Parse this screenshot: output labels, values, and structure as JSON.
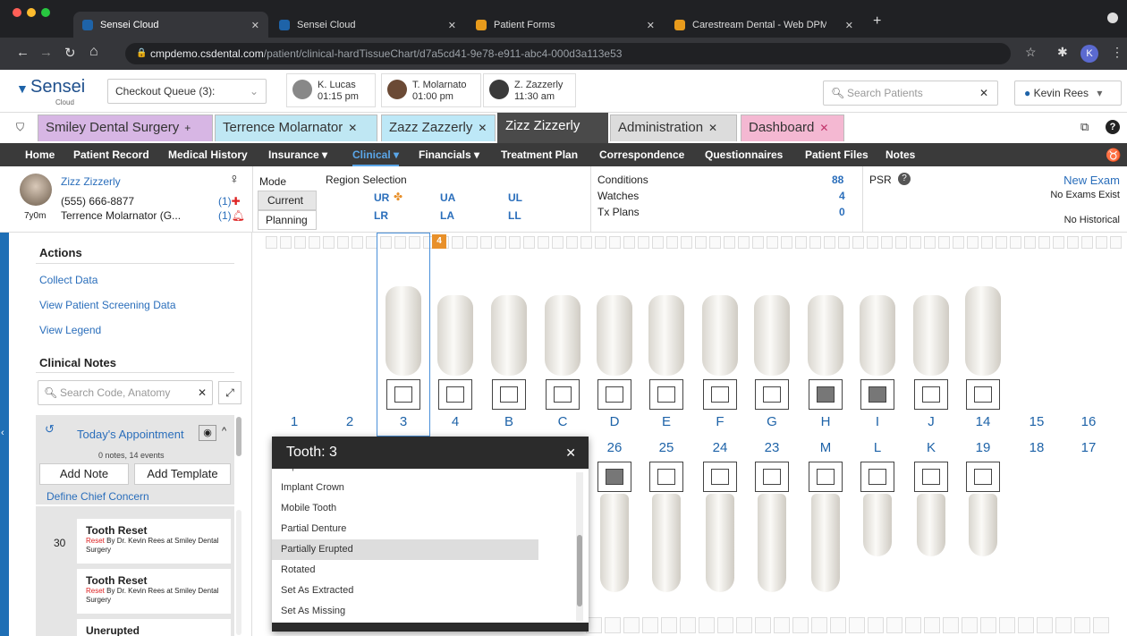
{
  "browser": {
    "tabs": [
      "Sensei Cloud",
      "Sensei Cloud",
      "Patient Forms",
      "Carestream Dental - Web DPM"
    ],
    "url_host": "cmpdemo.csdental.com",
    "url_path": "/patient/clinical-hardTissueChart/d7a5cd41-9e78-e911-abc4-000d3a113e53",
    "profile_initial": "K"
  },
  "app": {
    "logo": "Sensei",
    "logo_sub": "Cloud",
    "queue": "Checkout Queue (3):",
    "appointments": [
      {
        "name": "K. Lucas",
        "time": "01:15 pm"
      },
      {
        "name": "T. Molarnato",
        "time": "01:00 pm"
      },
      {
        "name": "Z. Zazzerly",
        "time": "11:30 am"
      }
    ],
    "search_placeholder": "Search Patients",
    "user": "Kevin Rees"
  },
  "patient_tabs": [
    {
      "label": "Smiley Dental Surgery",
      "color": "#d7b6e4"
    },
    {
      "label": "Terrence Molarnator",
      "color": "#bfe7f3"
    },
    {
      "label": "Zazz Zazzerly",
      "color": "#bde8f7"
    },
    {
      "label": "Zizz Zizzerly",
      "color": "#4a4a4a"
    },
    {
      "label": "Administration",
      "color": "#dcdcdc"
    },
    {
      "label": "Dashboard",
      "color": "#f4b8d2"
    }
  ],
  "menu": [
    "Home",
    "Patient Record",
    "Medical History",
    "Insurance",
    "Clinical",
    "Financials",
    "Treatment Plan",
    "Correspondence",
    "Questionnaires",
    "Patient Files",
    "Notes"
  ],
  "patient": {
    "name": "Zizz Zizzerly",
    "phone": "(555) 666-8877",
    "age": "7y0m",
    "guarantor": "Terrence Molarnator (G...",
    "alert1": "(1)",
    "alert2": "(1)"
  },
  "mode": {
    "label": "Mode",
    "current": "Current",
    "planning": "Planning"
  },
  "region": {
    "label": "Region Selection",
    "ur": "UR",
    "ua": "UA",
    "ul": "UL",
    "lr": "LR",
    "la": "LA",
    "ll": "LL"
  },
  "summary": [
    {
      "label": "Conditions",
      "value": "88"
    },
    {
      "label": "Watches",
      "value": "4"
    },
    {
      "label": "Tx Plans",
      "value": "0"
    }
  ],
  "psr": "PSR",
  "exam": {
    "new": "New Exam",
    "none": "No Exams Exist",
    "historical": "No Historical"
  },
  "sidebar": {
    "actions_title": "Actions",
    "actions": [
      "Collect Data",
      "View Patient Screening Data",
      "View Legend"
    ],
    "notes_title": "Clinical Notes",
    "notes_search": "Search Code, Anatomy",
    "appt_title": "Today's Appointment",
    "appt_sub": "0 notes, 14 events",
    "add_note": "Add Note",
    "add_template": "Add Template",
    "chief": "Define Chief Concern",
    "events": [
      {
        "num": "30",
        "title": "Tooth Reset",
        "reset": "Reset",
        "by": " By Dr. Kevin Rees at Smiley Dental Surgery"
      },
      {
        "num": "",
        "title": "Tooth Reset",
        "reset": "Reset",
        "by": " By Dr. Kevin Rees at Smiley Dental Surgery"
      },
      {
        "num": "",
        "title": "Unerupted",
        "reset": "",
        "by": ""
      }
    ]
  },
  "chart": {
    "upper_numbers": [
      "1",
      "2",
      "3",
      "4",
      "B",
      "C",
      "D",
      "E",
      "F",
      "G",
      "H",
      "I",
      "J",
      "14",
      "15",
      "16"
    ],
    "lower_numbers": [
      "26",
      "25",
      "24",
      "23",
      "M",
      "L",
      "K",
      "19",
      "18",
      "17"
    ],
    "marker": "4"
  },
  "popup": {
    "title": "Tooth: 3",
    "options": [
      "Implant Crown",
      "Mobile Tooth",
      "Partial Denture",
      "Partially Erupted",
      "Rotated",
      "Set As Extracted",
      "Set As Missing"
    ]
  }
}
